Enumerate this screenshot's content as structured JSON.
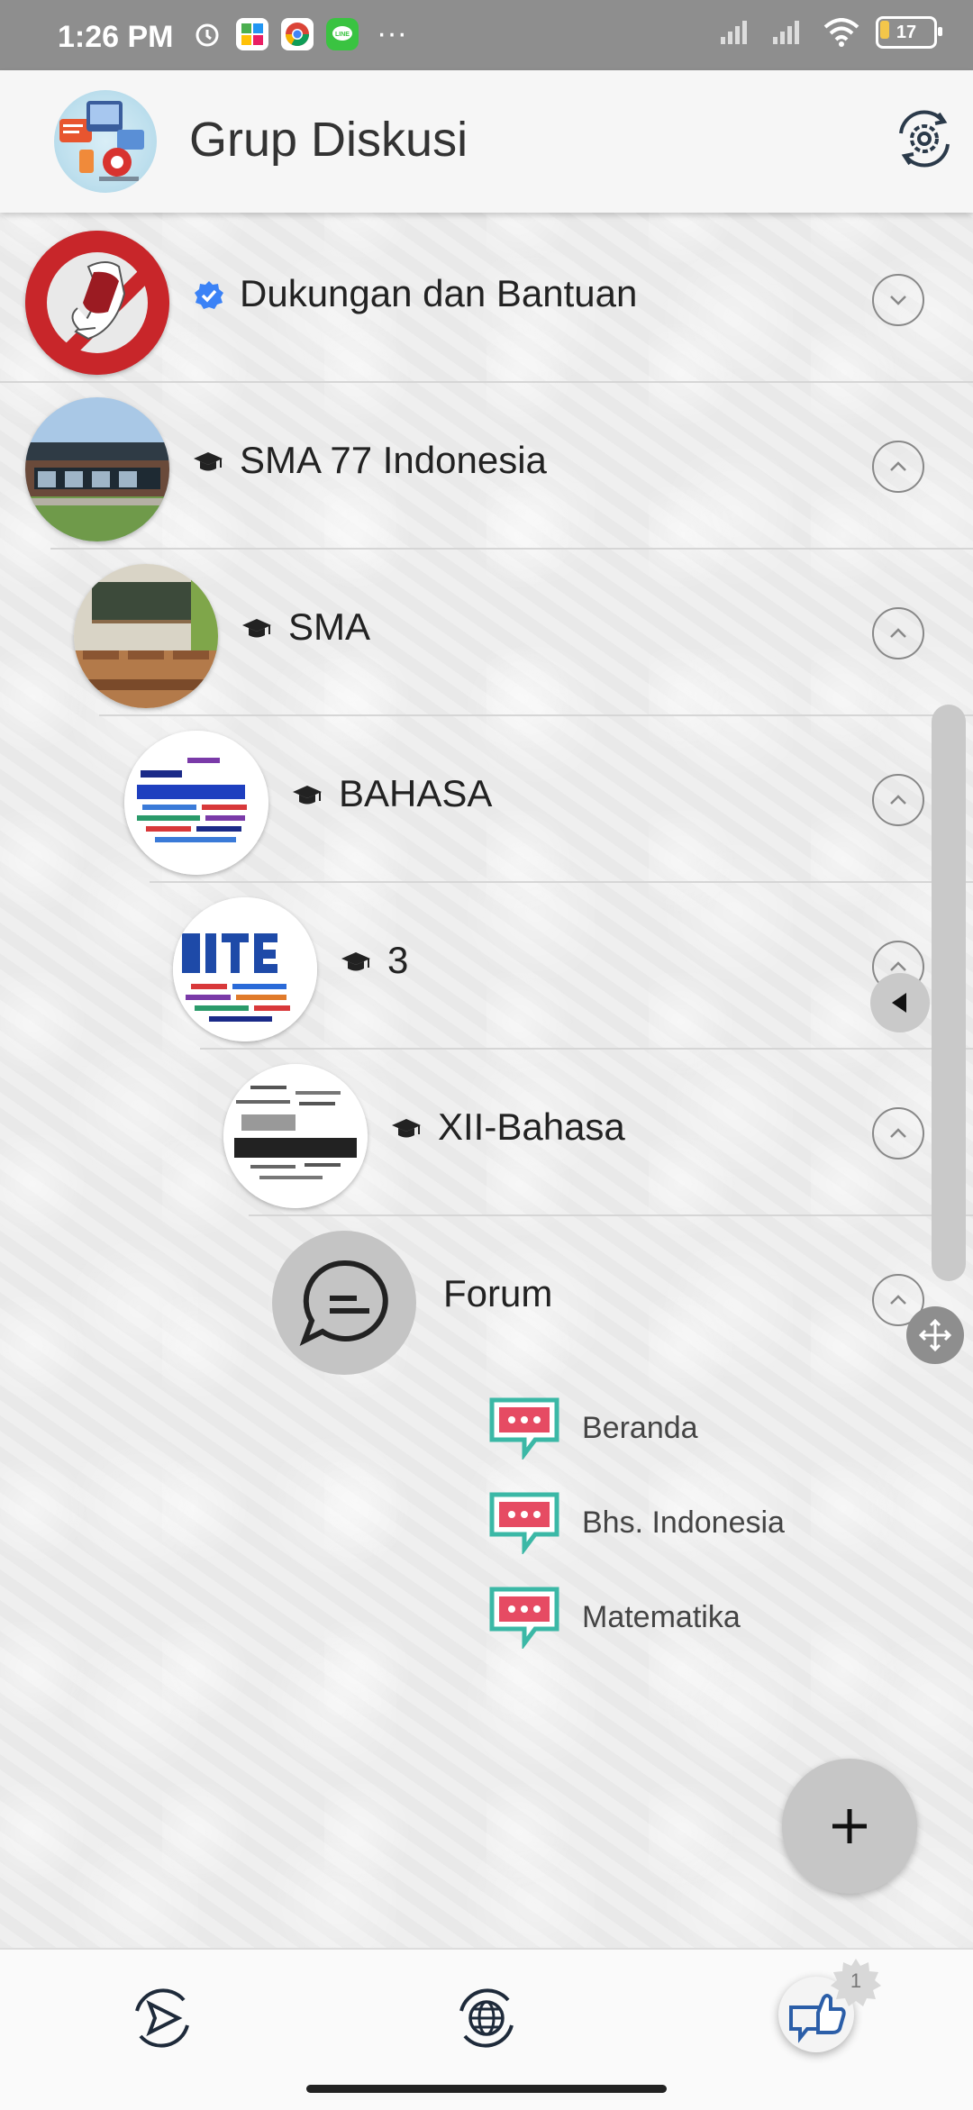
{
  "status_bar": {
    "time": "1:26 PM",
    "icons": [
      "alarm-icon",
      "app-icon",
      "chrome-icon",
      "line-icon"
    ],
    "more": "···",
    "battery": "17"
  },
  "app_bar": {
    "title": "Grup Diskusi",
    "settings_icon": "settings-sync-icon"
  },
  "tree": [
    {
      "label": "Dukungan dan Bantuan",
      "badge": "verified",
      "expanded": false
    },
    {
      "label": "SMA 77 Indonesia",
      "badge": "school",
      "expanded": true
    },
    {
      "label": "SMA",
      "badge": "school",
      "expanded": true
    },
    {
      "label": "BAHASA",
      "badge": "school",
      "expanded": true
    },
    {
      "label": "3",
      "badge": "school",
      "expanded": true
    },
    {
      "label": "XII-Bahasa",
      "badge": "school",
      "expanded": true
    },
    {
      "label": "Forum",
      "badge": "",
      "expanded": true
    }
  ],
  "forum_items": [
    {
      "label": "Beranda"
    },
    {
      "label": "Bhs. Indonesia"
    },
    {
      "label": "Matematika"
    }
  ],
  "bottom_nav": {
    "items": [
      "send-sync-icon",
      "globe-sync-icon",
      "thumbs-up-icon"
    ],
    "badge_count": "1"
  },
  "colors": {
    "accent_teal": "#3bb8a6",
    "chat_red": "#e64b63",
    "verified_blue": "#3b82f6",
    "chevron_gray": "#888888"
  }
}
